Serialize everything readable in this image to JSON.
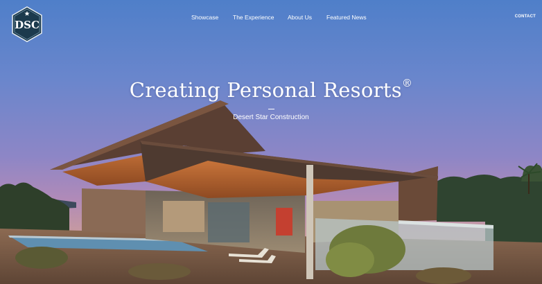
{
  "brand": {
    "logo_text": "DSC"
  },
  "nav": {
    "items": [
      {
        "label": "Showcase"
      },
      {
        "label": "The Experience"
      },
      {
        "label": "About Us"
      },
      {
        "label": "Featured News"
      }
    ],
    "contact_label": "CONTACT"
  },
  "hero": {
    "title": "Creating Personal Resorts",
    "title_mark": "®",
    "subtitle": "Desert Star Construction"
  },
  "colors": {
    "sky_top": "#4f7fc9",
    "sky_horizon": "#d8a886",
    "logo_fill": "#1c3a4d",
    "roof_wood": "#b8642e"
  }
}
